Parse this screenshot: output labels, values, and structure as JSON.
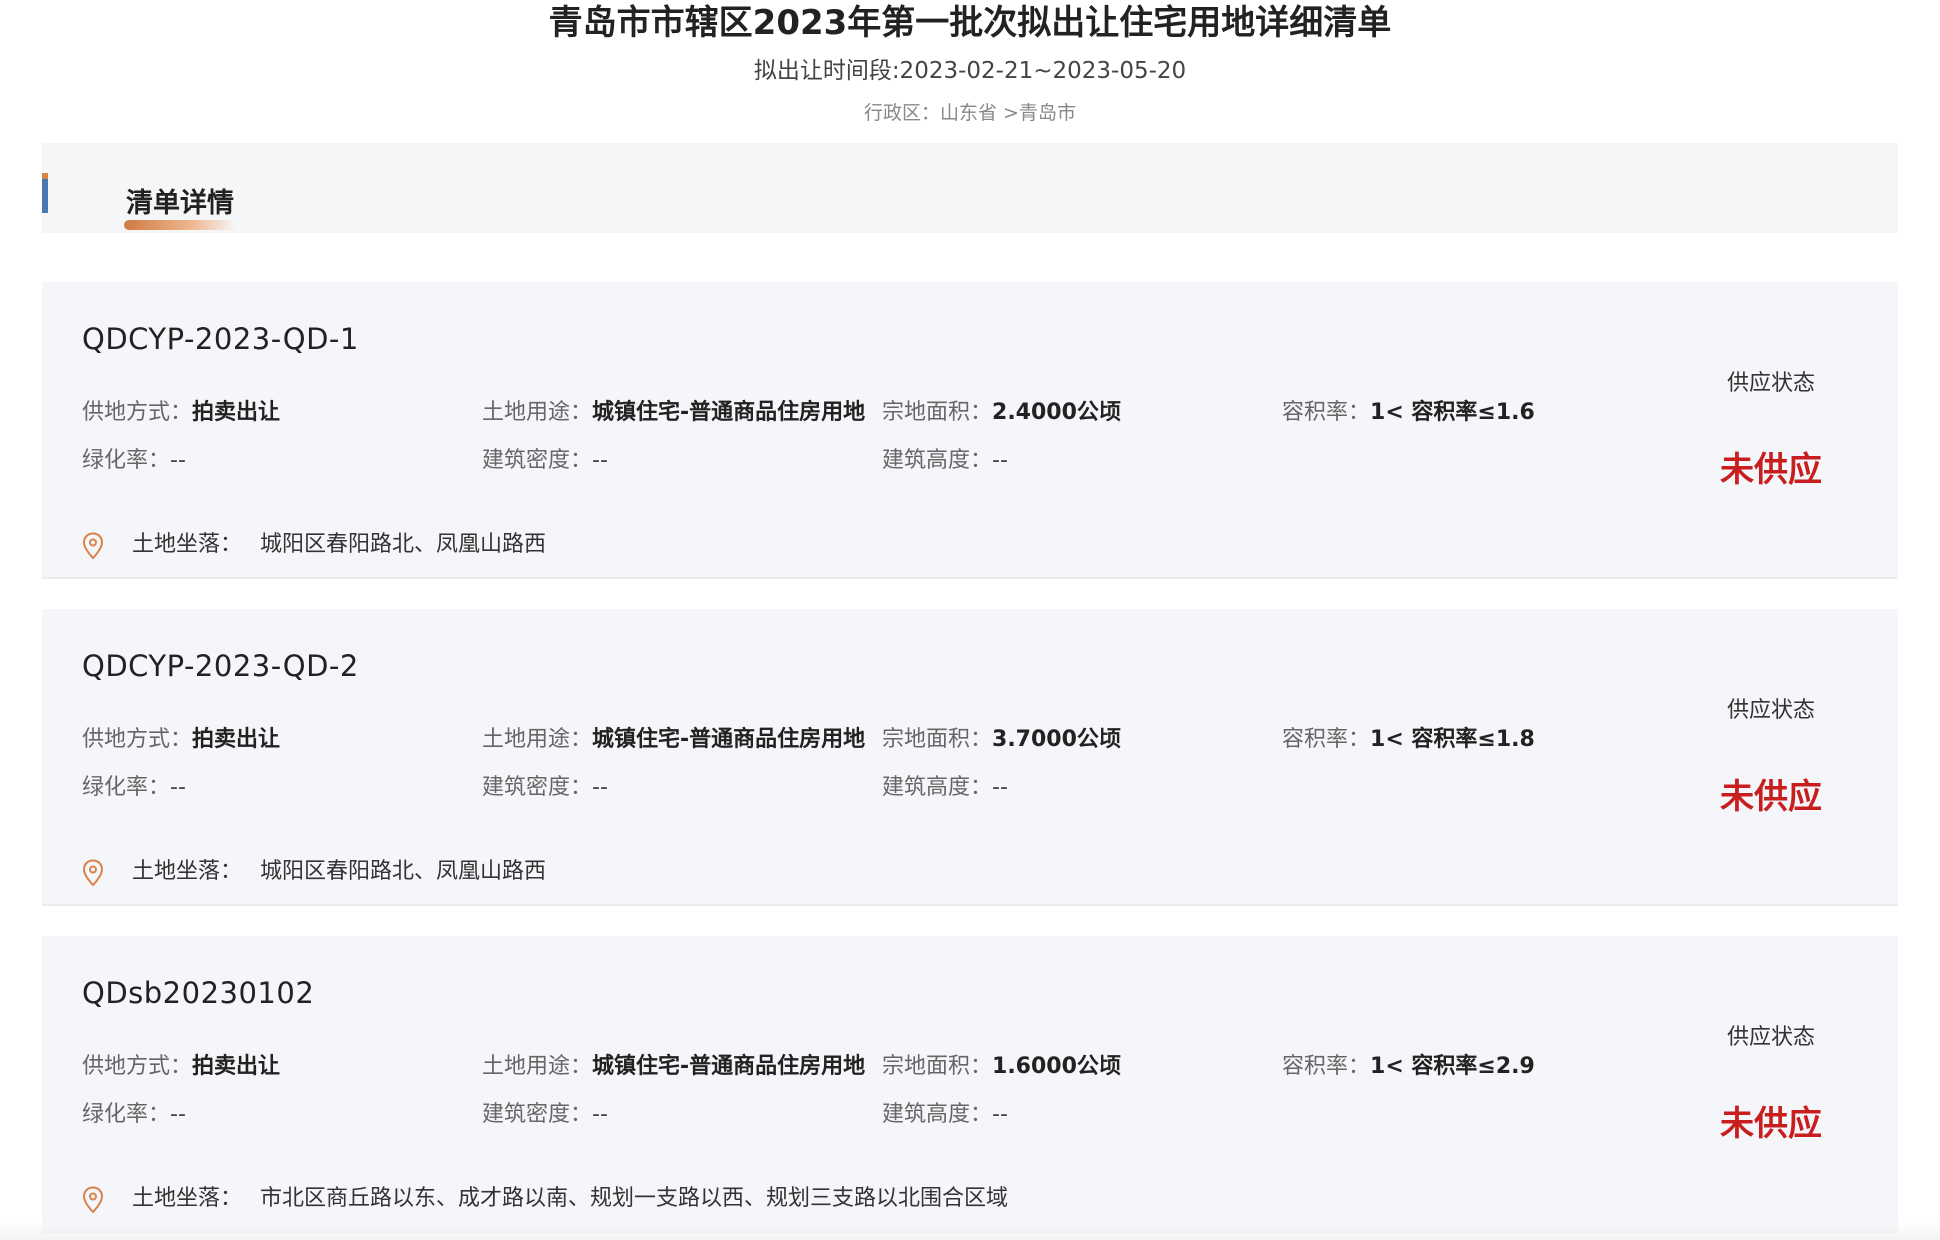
{
  "header": {
    "title": "青岛市市辖区2023年第一批次拟出让住宅用地详细清单",
    "subtitle": "拟出让时间段:2023-02-21~2023-05-20",
    "region": "行政区：山东省 >青岛市"
  },
  "section": {
    "title": "清单详情"
  },
  "labels": {
    "supply_method": "供地方式：",
    "land_use": "土地用途：",
    "area": "宗地面积：",
    "far": "容积率：",
    "green": "绿化率：",
    "density": "建筑密度：",
    "height": "建筑高度：",
    "location": "土地坐落：",
    "status": "供应状态"
  },
  "parcels": [
    {
      "code": "QDCYP-2023-QD-1",
      "supply_method": "拍卖出让",
      "land_use": "城镇住宅-普通商品住房用地",
      "area": "2.4000公顷",
      "far": "1< 容积率≤1.6",
      "green": "--",
      "density": "--",
      "height": "--",
      "status": "未供应",
      "location": "城阳区春阳路北、凤凰山路西"
    },
    {
      "code": "QDCYP-2023-QD-2",
      "supply_method": "拍卖出让",
      "land_use": "城镇住宅-普通商品住房用地",
      "area": "3.7000公顷",
      "far": "1< 容积率≤1.8",
      "green": "--",
      "density": "--",
      "height": "--",
      "status": "未供应",
      "location": "城阳区春阳路北、凤凰山路西"
    },
    {
      "code": "QDsb20230102",
      "supply_method": "拍卖出让",
      "land_use": "城镇住宅-普通商品住房用地",
      "area": "1.6000公顷",
      "far": "1< 容积率≤2.9",
      "green": "--",
      "density": "--",
      "height": "--",
      "status": "未供应",
      "location": "市北区商丘路以东、成才路以南、规划一支路以西、规划三支路以北围合区域"
    }
  ],
  "colors": {
    "status": "#c81e1e",
    "accent": "#4a78b5",
    "underline": "#d07a42",
    "pin": "#d9824a"
  },
  "icons": {
    "location": "map-pin-icon"
  }
}
